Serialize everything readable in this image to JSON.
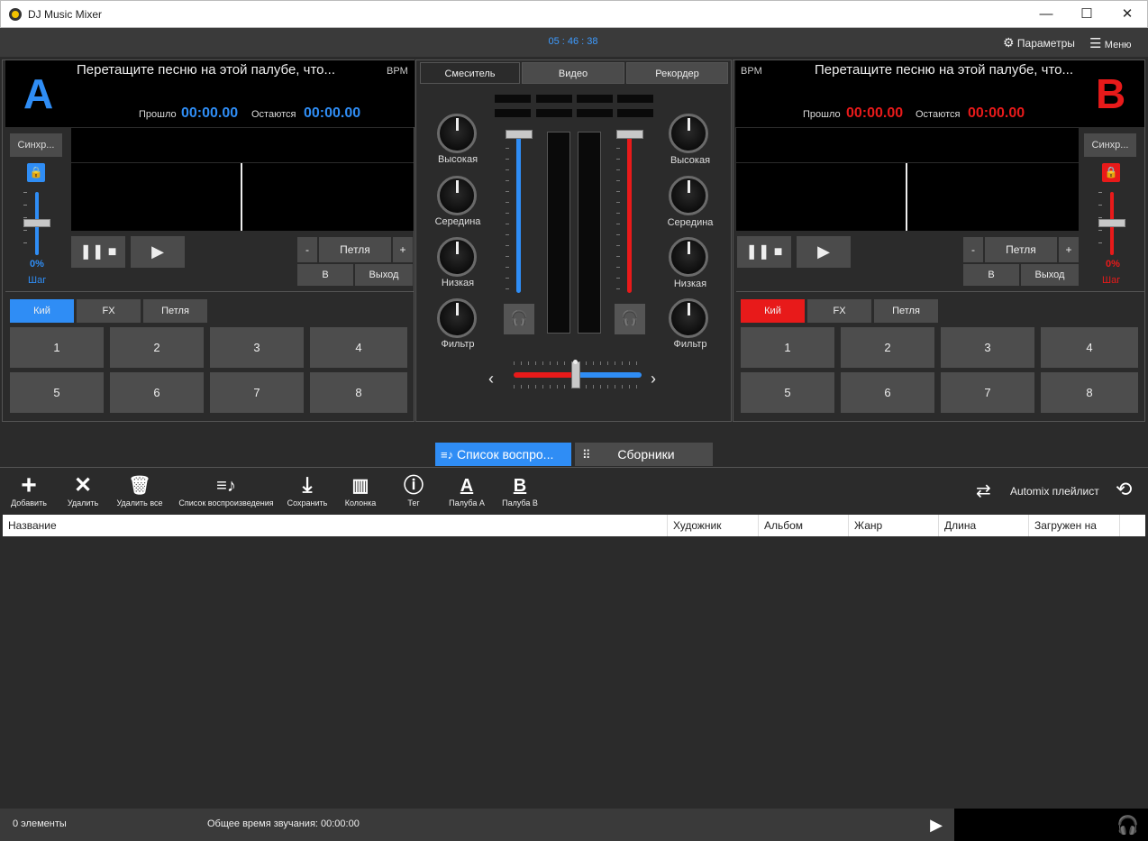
{
  "window": {
    "title": "DJ Music Mixer",
    "minimize": "—",
    "maximize": "☐",
    "close": "✕"
  },
  "topbar": {
    "clock": "05 : 46 : 38",
    "params_label": "Параметры",
    "menu_label": "Меню"
  },
  "deckA": {
    "letter": "A",
    "title": "Перетащите песню на этой палубе, что...",
    "bpm": "BPM",
    "elapsed_label": "Прошло",
    "elapsed": "00:00.00",
    "remaining_label": "Остаются",
    "remaining": "00:00.00",
    "sync": "Синхр...",
    "pitch_pct": "0%",
    "step": "Шаг",
    "loop_minus": "-",
    "loop": "Петля",
    "loop_plus": "+",
    "in": "В",
    "out": "Выход",
    "tabs": [
      "Кий",
      "FX",
      "Петля"
    ],
    "pads": [
      "1",
      "2",
      "3",
      "4",
      "5",
      "6",
      "7",
      "8"
    ],
    "color": "#2f8df5"
  },
  "deckB": {
    "letter": "B",
    "title": "Перетащите песню на этой палубе, что...",
    "bpm": "BPM",
    "elapsed_label": "Прошло",
    "elapsed": "00:00.00",
    "remaining_label": "Остаются",
    "remaining": "00:00.00",
    "sync": "Синхр...",
    "pitch_pct": "0%",
    "step": "Шаг",
    "loop_minus": "-",
    "loop": "Петля",
    "loop_plus": "+",
    "in": "В",
    "out": "Выход",
    "tabs": [
      "Кий",
      "FX",
      "Петля"
    ],
    "pads": [
      "1",
      "2",
      "3",
      "4",
      "5",
      "6",
      "7",
      "8"
    ],
    "color": "#e81a1a"
  },
  "mixer": {
    "tabs": [
      "Смеситель",
      "Видео",
      "Рекордер"
    ],
    "knobs": [
      "Высокая",
      "Середина",
      "Низкая",
      "Фильтр"
    ]
  },
  "lower_tabs": {
    "playlist": "Список воспро...",
    "collections": "Сборники"
  },
  "toolbar": {
    "items": [
      "Добавить",
      "Удалить",
      "Удалить все",
      "Список воспроизведения",
      "Сохранить",
      "Колонка",
      "Тег",
      "Палуба A",
      "Палуба B"
    ],
    "automix": "Automix плейлист"
  },
  "table": {
    "columns": [
      "Название",
      "Художник",
      "Альбом",
      "Жанр",
      "Длина",
      "Загружен на"
    ]
  },
  "status": {
    "count": "0  элементы",
    "total": "Общее время звучания: 00:00:00"
  }
}
